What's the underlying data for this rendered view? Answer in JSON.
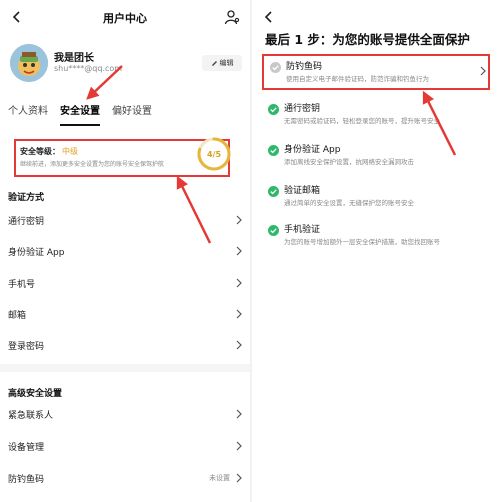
{
  "left": {
    "title": "用户中心",
    "profile": {
      "nickname": "我是团长",
      "email": "shu****@qq.com",
      "edit_label": "编辑"
    },
    "tabs": [
      {
        "label": "个人资料",
        "active": false
      },
      {
        "label": "安全设置",
        "active": true
      },
      {
        "label": "偏好设置",
        "active": false
      }
    ],
    "security_card": {
      "level_label": "安全等级：",
      "level_value": "中级",
      "description": "继续前进，添加更多安全设置为您的账号安全保驾护航",
      "score_text": "4/5",
      "score_fraction": 0.8
    },
    "verify_section": {
      "title": "验证方式",
      "items": [
        "通行密钥",
        "身份验证 App",
        "手机号",
        "邮箱",
        "登录密码"
      ]
    },
    "advanced_section": {
      "title": "高级安全设置",
      "items": [
        {
          "label": "紧急联系人",
          "value": ""
        },
        {
          "label": "设备管理",
          "value": ""
        },
        {
          "label": "防钓鱼码",
          "value": "未设置"
        }
      ]
    }
  },
  "right": {
    "heading": "最后 1 步：为您的账号提供全面保护",
    "options": [
      {
        "name": "防钓鱼码",
        "desc": "使用自定义电子邮件验证码，防范诈骗和钓鱼行为",
        "done": false,
        "highlight": true
      },
      {
        "name": "通行密钥",
        "desc": "无需密码或验证码，轻松登录您的账号，提升账号安全",
        "done": true,
        "highlight": false
      },
      {
        "name": "身份验证 App",
        "desc": "添加离线安全保护设置，抗网络安全漏洞攻击",
        "done": true,
        "highlight": false
      },
      {
        "name": "验证邮箱",
        "desc": "通过简单的安全设置，无缝保护您的账号安全",
        "done": true,
        "highlight": false
      },
      {
        "name": "手机验证",
        "desc": "为您的账号增加额外一层安全保护措施，助您找回账号",
        "done": true,
        "highlight": false
      }
    ]
  },
  "colors": {
    "accent_red": "#e53935",
    "success_green": "#2db86a",
    "level_yellow": "#e0a020",
    "pending_gray": "#c8c8c8"
  },
  "icons": [
    "back-arrow-icon",
    "user-settings-icon",
    "edit-icon",
    "chevron-right-icon",
    "check-circle-icon"
  ]
}
